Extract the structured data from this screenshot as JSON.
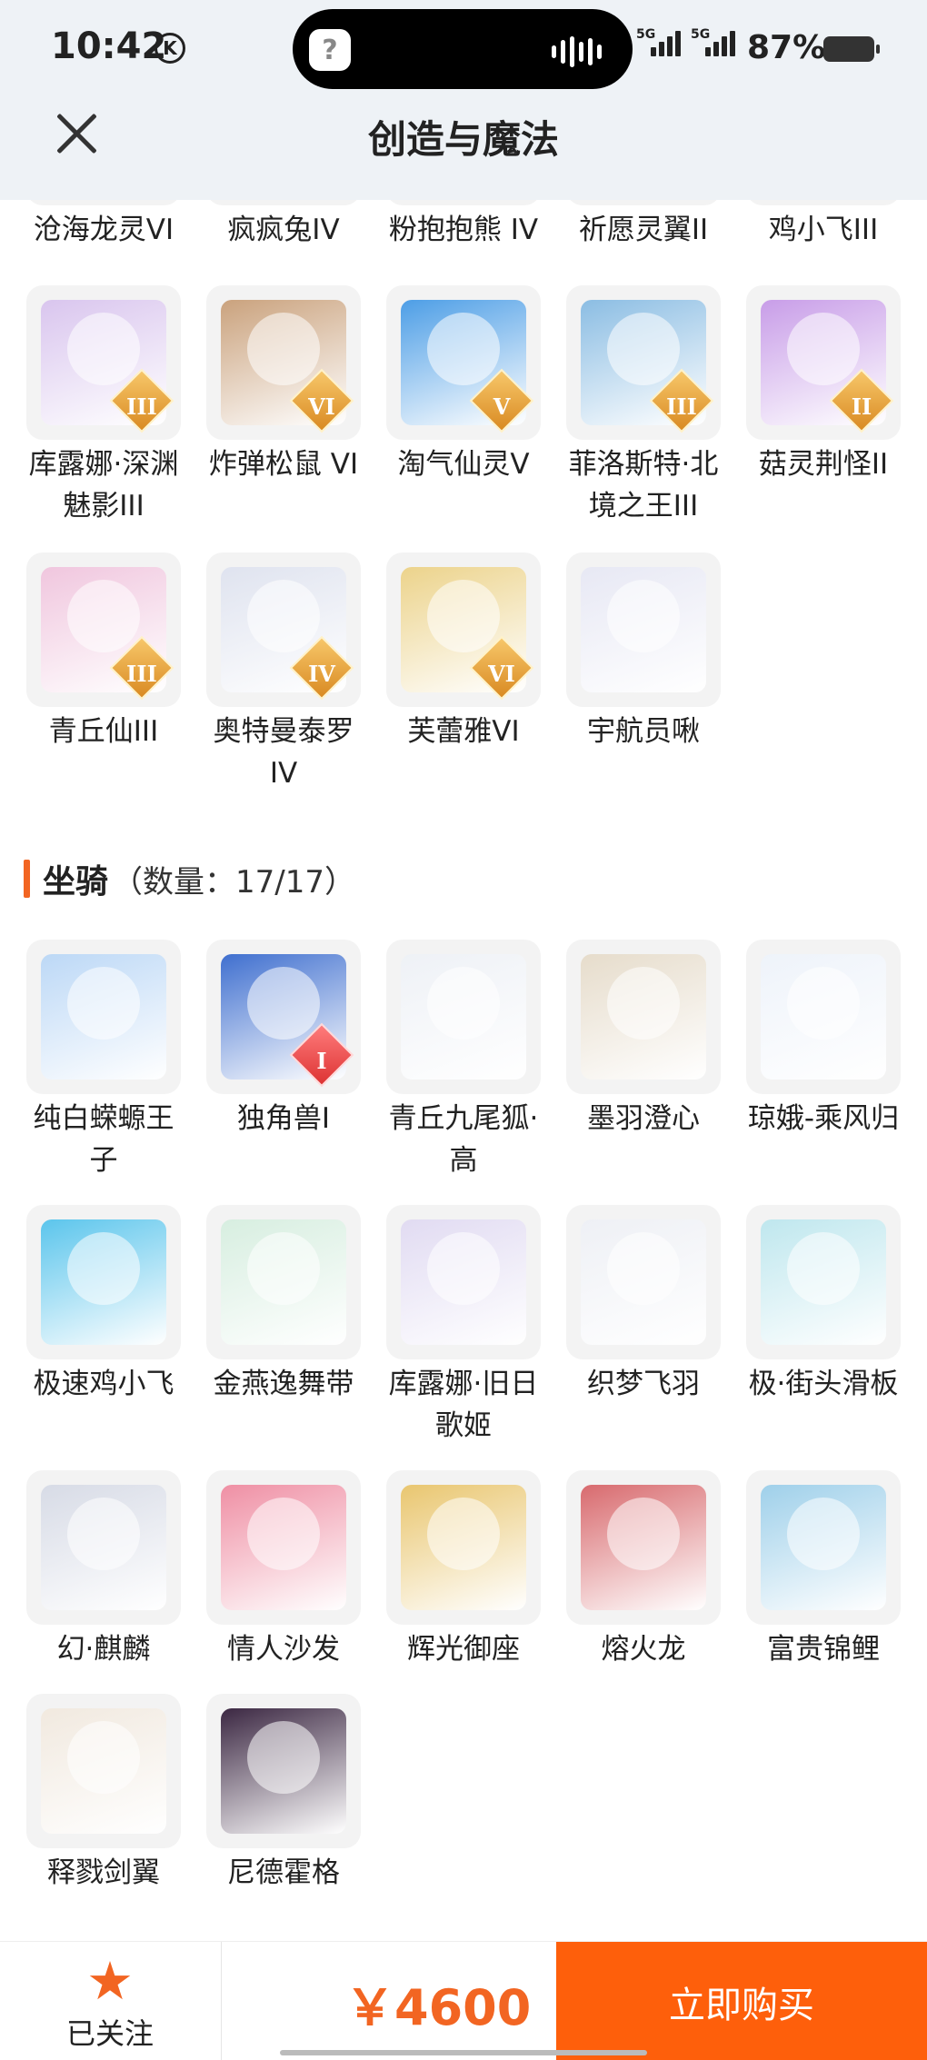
{
  "status_bar": {
    "time": "10:42",
    "time_icon": "k-circle-icon",
    "network1": "5G",
    "network2": "5G",
    "battery": "87%"
  },
  "header": {
    "title": "创造与魔法",
    "close_icon": "close-icon"
  },
  "pets_partial": [
    {
      "label": "沧海龙灵VI",
      "color": "#cbe7f0"
    },
    {
      "label": "疯疯兔IV",
      "color": "#f2d9c9"
    },
    {
      "label": "粉抱抱熊 IV",
      "color": "#f6c9d9"
    },
    {
      "label": "祈愿灵翼II",
      "color": "#e9c79b"
    },
    {
      "label": "鸡小飞III",
      "color": "#f1d5b9"
    }
  ],
  "pets": [
    {
      "label": "库露娜·深渊魅影III",
      "badge": "III",
      "color": "#d9c5ee"
    },
    {
      "label": "炸弹松鼠 VI",
      "badge": "VI",
      "color": "#caa27d"
    },
    {
      "label": "淘气仙灵V",
      "badge": "V",
      "color": "#4d9ee6"
    },
    {
      "label": "菲洛斯特·北境之王III",
      "badge": "III",
      "color": "#8bbde3"
    },
    {
      "label": "菇灵荆怪II",
      "badge": "II",
      "color": "#c89de8"
    },
    {
      "label": "青丘仙III",
      "badge": "III",
      "color": "#f0c6de"
    },
    {
      "label": "奥特曼泰罗IV",
      "badge": "IV",
      "color": "#dfe3ef"
    },
    {
      "label": "芙蕾雅VI",
      "badge": "VI",
      "color": "#ecd38b"
    },
    {
      "label": "宇航员啾",
      "badge": "",
      "color": "#e7e8f4"
    }
  ],
  "mounts_section": {
    "title": "坐骑",
    "count": "（数量：17/17）"
  },
  "mounts": [
    {
      "label": "纯白蝾螈王子",
      "badge": "",
      "color": "#bcd8f6"
    },
    {
      "label": "独角兽I",
      "badge": "I",
      "color": "#3f6fcf"
    },
    {
      "label": "青丘九尾狐·高",
      "badge": "",
      "color": "#eef1f6"
    },
    {
      "label": "墨羽澄心",
      "badge": "",
      "color": "#e6dccb"
    },
    {
      "label": "琼娥-乘风归",
      "badge": "",
      "color": "#eef3fa"
    },
    {
      "label": "极速鸡小飞",
      "badge": "",
      "color": "#5bc5ec"
    },
    {
      "label": "金燕逸舞带",
      "badge": "",
      "color": "#d7eee0"
    },
    {
      "label": "库露娜·旧日歌姬",
      "badge": "",
      "color": "#e1dbf2"
    },
    {
      "label": "织梦飞羽",
      "badge": "",
      "color": "#eef0f5"
    },
    {
      "label": "极·街头滑板",
      "badge": "",
      "color": "#bfe7ee"
    },
    {
      "label": "幻·麒麟",
      "badge": "",
      "color": "#d7dbe6"
    },
    {
      "label": "情人沙发",
      "badge": "",
      "color": "#ef8fa4"
    },
    {
      "label": "辉光御座",
      "badge": "",
      "color": "#e9c66f"
    },
    {
      "label": "熔火龙",
      "badge": "",
      "color": "#d86a6e"
    },
    {
      "label": "富贵锦鲤",
      "badge": "",
      "color": "#9fd0ea"
    },
    {
      "label": "释戮剑翼",
      "badge": "",
      "color": "#f1e9df"
    },
    {
      "label": "尼德霍格",
      "badge": "",
      "color": "#3b2742"
    }
  ],
  "bottom_bar": {
    "follow_label": "已关注",
    "follow_icon": "star-icon",
    "price": "￥4600",
    "buy_label": "立即购买",
    "accent": "#fe5f0b"
  }
}
